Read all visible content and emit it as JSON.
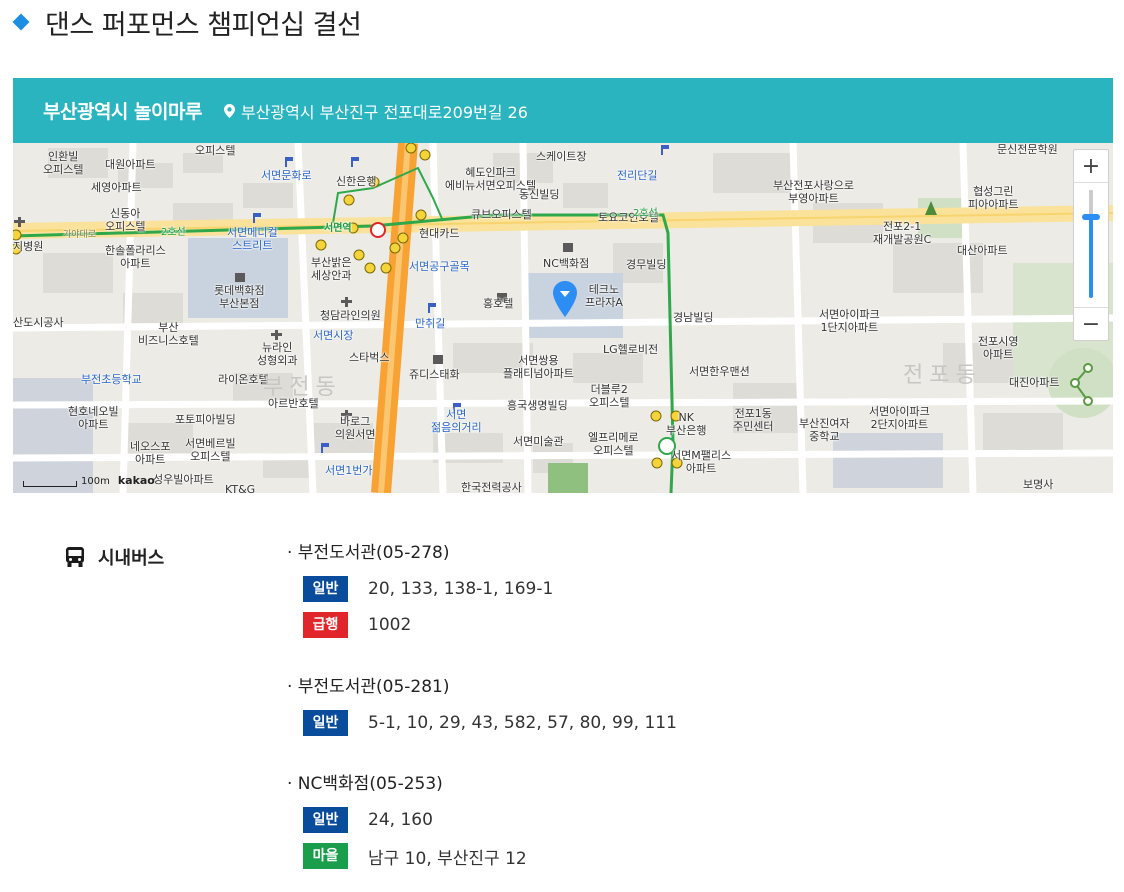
{
  "page": {
    "title": "댄스 퍼포먼스 챔피언십 결선"
  },
  "venue": {
    "name": "부산광역시 놀이마루",
    "address": "부산광역시 부산진구 전포대로209번길 26"
  },
  "map": {
    "labels": {
      "l1": "오피스텔",
      "l2": "인환빌\n오피스텔",
      "l3": "대원아파트",
      "l4": "세영아파트",
      "l5": "서면문화로",
      "l6": "신한은행",
      "l7": "혜도인파크\n에비뉴서면오피스텔",
      "l8": "동신빌딩",
      "l9": "전리단길",
      "l10": "스케이트장",
      "l11": "부산전포사랑으로\n부영아파트",
      "l12": "협성그린\n피아아파트",
      "l13": "신동아\n오피스텔",
      "l14": "서면메디컬\n스트리트",
      "l15": "서면역",
      "l16": "현대카드",
      "l17": "큐브오피스텔",
      "l18": "토요코인호텔",
      "l19": "전포2-1\n재개발공원C",
      "l20": "대산아파트",
      "l21": "한솔폴라리스\n아파트",
      "l22": "부산밝은\n세상안과",
      "l23": "서면공구골목",
      "l24": "NC백화점",
      "l25": "경무빌딩",
      "l26": "롯데백화점\n부산본점",
      "l27": "청담라인의원",
      "l28": "만취길",
      "l29": "홍호텔",
      "l30": "테크노\n프라자A",
      "l31": "경남빌딩",
      "l32": "서면아이파크\n1단지아파트",
      "l33": "산도시공사",
      "l34": "부산\n비즈니스호텔",
      "l35": "뉴라인\n성형외과",
      "l36": "서면시장",
      "l37": "스타벅스",
      "l38": "LG헬로비전",
      "l39": "전포시영\n아파트",
      "l40": "부전초등학교",
      "l41": "라이온호텔",
      "l42": "쥬디스태화",
      "l43": "서면쌍용\n플래티넘아파트",
      "l44": "서면한우맨션",
      "l45": "대진아파트",
      "l46": "아르반호텔",
      "l47": "더블루2\n오피스텔",
      "l48": "흥국생명빌딩",
      "l49": "현호네오빌\n아파트",
      "l50": "포토피아빌딩",
      "l51": "바로그\n의원서면",
      "l52": "서면\n젊음의거리",
      "l53": "NK\n부산은행",
      "l54": "전포1동\n주민센터",
      "l55": "부산진여자\n중학교",
      "l56": "서면아이파크\n2단지아파트",
      "l57": "네오스포\n아파트",
      "l58": "서면베르빌\n오피스텔",
      "l59": "서면미술관",
      "l60": "엘프리메로\n오피스텔",
      "l61": "서면M팰리스\n아파트",
      "l62": "서면1번가",
      "l63": "한국전력공사",
      "l64": "성우빌아파트",
      "l65": "보명사",
      "l66": "문신전문학원",
      "l67": "부전동",
      "l68": "전포동",
      "l69": "2호선",
      "l70": "가야대로",
      "l71": "지병원",
      "l72": "2호선",
      "l73": "KT&G"
    },
    "scale": "100m",
    "brand": "kakao",
    "zoom_in": "+",
    "zoom_out": "−",
    "zoom_level": 0.78,
    "colors": {
      "subway": "#2ea84a",
      "road_main": "#f7a233",
      "marker": "#2c8ef5"
    }
  },
  "transit": {
    "label": "시내버스",
    "stops": [
      {
        "name": "· 부전도서관(05-278)",
        "routes": [
          {
            "type": "일반",
            "color": "#0a4c9c",
            "numbers": "20, 133, 138-1, 169-1"
          },
          {
            "type": "급행",
            "color": "#e0262b",
            "numbers": "1002"
          }
        ]
      },
      {
        "name": "· 부전도서관(05-281)",
        "routes": [
          {
            "type": "일반",
            "color": "#0a4c9c",
            "numbers": "5-1, 10, 29, 43, 582, 57, 80, 99, 111"
          }
        ]
      },
      {
        "name": "· NC백화점(05-253)",
        "routes": [
          {
            "type": "일반",
            "color": "#0a4c9c",
            "numbers": "24, 160"
          },
          {
            "type": "마을",
            "color": "#1a9e4b",
            "numbers": "남구 10, 부산진구 12"
          }
        ]
      }
    ]
  }
}
